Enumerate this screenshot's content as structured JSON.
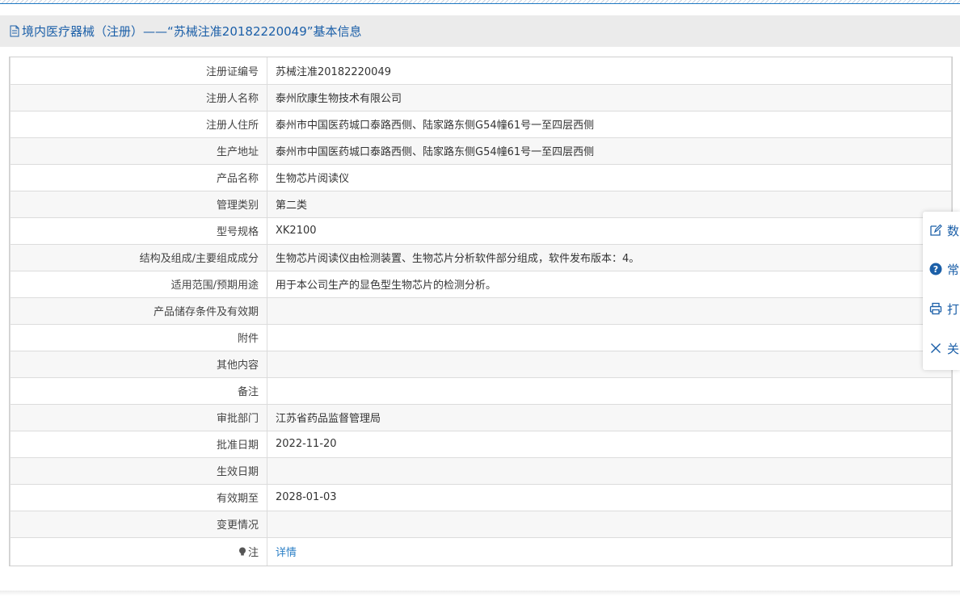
{
  "header": {
    "title": "境内医疗器械（注册）——“苏械注准20182220049”基本信息"
  },
  "rows": [
    {
      "label": "注册证编号",
      "value": "苏械注准20182220049"
    },
    {
      "label": "注册人名称",
      "value": "泰州欣康生物技术有限公司"
    },
    {
      "label": "注册人住所",
      "value": "泰州市中国医药城口泰路西侧、陆家路东侧G54幢61号一至四层西侧"
    },
    {
      "label": "生产地址",
      "value": "泰州市中国医药城口泰路西侧、陆家路东侧G54幢61号一至四层西侧"
    },
    {
      "label": "产品名称",
      "value": "生物芯片阅读仪"
    },
    {
      "label": "管理类别",
      "value": "第二类"
    },
    {
      "label": "型号规格",
      "value": "XK2100"
    },
    {
      "label": "结构及组成/主要组成成分",
      "value": "生物芯片阅读仪由检测装置、生物芯片分析软件部分组成，软件发布版本：4。"
    },
    {
      "label": "适用范围/预期用途",
      "value": "用于本公司生产的显色型生物芯片的检测分析。"
    },
    {
      "label": "产品储存条件及有效期",
      "value": ""
    },
    {
      "label": "附件",
      "value": ""
    },
    {
      "label": "其他内容",
      "value": ""
    },
    {
      "label": "备注",
      "value": ""
    },
    {
      "label": "审批部门",
      "value": "江苏省药品监督管理局"
    },
    {
      "label": "批准日期",
      "value": "2022-11-20"
    },
    {
      "label": "生效日期",
      "value": ""
    },
    {
      "label": "有效期至",
      "value": "2028-01-03"
    },
    {
      "label": "变更情况",
      "value": ""
    },
    {
      "label": "注",
      "value": "详情"
    }
  ],
  "float_toolbar": {
    "items": [
      {
        "label": "数",
        "icon": "edit-icon"
      },
      {
        "label": "常",
        "icon": "help-icon"
      },
      {
        "label": "打",
        "icon": "print-icon"
      },
      {
        "label": "关",
        "icon": "close-icon"
      }
    ]
  },
  "colors": {
    "accent": "#1b5fa8",
    "link": "#2b7fc6",
    "header_bg": "#ebebeb",
    "row_alt_bg": "#f7f7f7"
  }
}
